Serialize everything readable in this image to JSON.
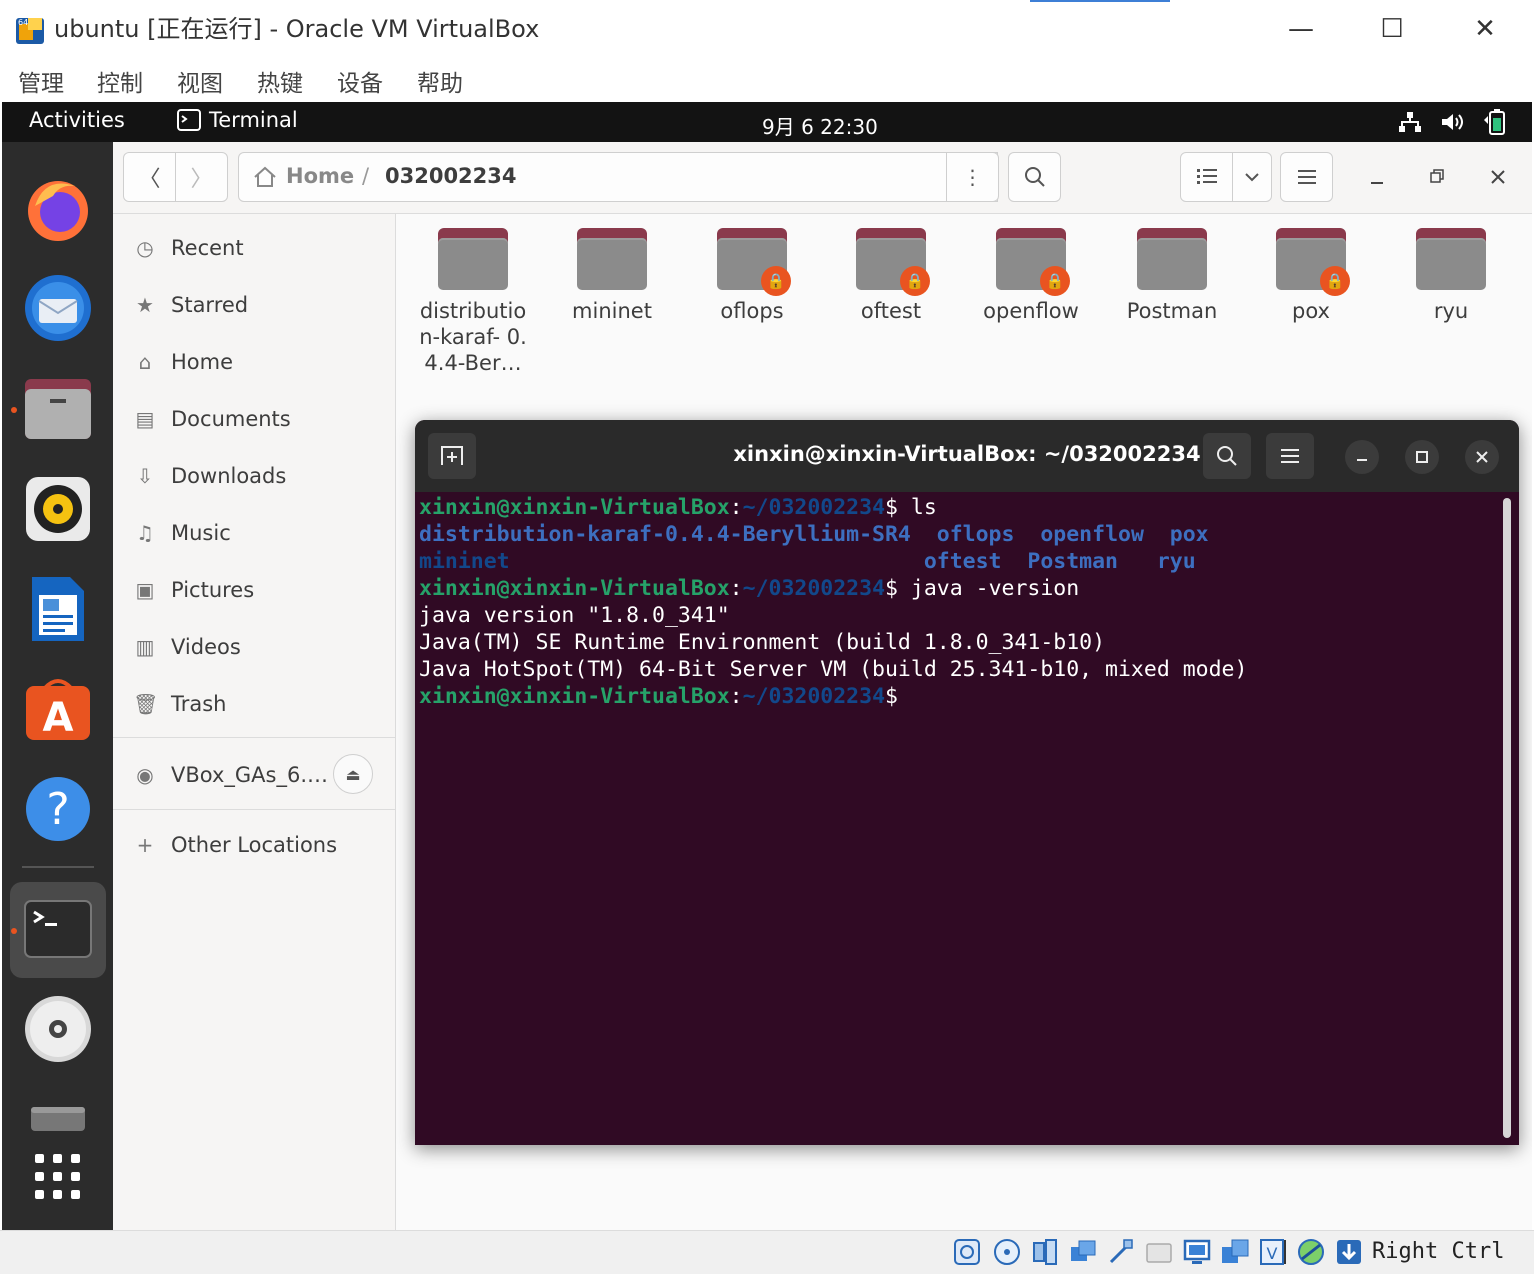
{
  "window": {
    "title": "ubuntu [正在运行] - Oracle VM VirtualBox",
    "app_icon": "virtualbox-icon",
    "controls": {
      "minimize": "—",
      "maximize": "☐",
      "close": "✕"
    }
  },
  "menubar": [
    "管理",
    "控制",
    "视图",
    "热键",
    "设备",
    "帮助"
  ],
  "gnome": {
    "activities": "Activities",
    "app_name": "Terminal",
    "clock": "9月 6  22:30",
    "tray_icons": [
      "network-icon",
      "volume-icon",
      "battery-icon"
    ]
  },
  "dock": [
    "firefox-icon",
    "thunderbird-icon",
    "files-icon",
    "rhythmbox-icon",
    "libreoffice-writer-icon",
    "ubuntu-software-icon",
    "help-icon",
    "terminal-icon",
    "dvd-icon",
    "drive-icon",
    "show-apps-icon"
  ],
  "files": {
    "path": {
      "home": "Home",
      "separator": "/",
      "current": "032002234"
    },
    "sidebar": [
      {
        "label": "Recent",
        "icon": "clock-icon"
      },
      {
        "label": "Starred",
        "icon": "star-icon"
      },
      {
        "label": "Home",
        "icon": "home-icon"
      },
      {
        "label": "Documents",
        "icon": "document-icon"
      },
      {
        "label": "Downloads",
        "icon": "download-icon"
      },
      {
        "label": "Music",
        "icon": "music-icon"
      },
      {
        "label": "Pictures",
        "icon": "picture-icon"
      },
      {
        "label": "Videos",
        "icon": "video-icon"
      },
      {
        "label": "Trash",
        "icon": "trash-icon"
      }
    ],
    "device": "VBox_GAs_6.…",
    "other_locations": "Other Locations",
    "folders": [
      {
        "name": "distributio n-karaf- 0.4.4-Ber…",
        "locked": false
      },
      {
        "name": "mininet",
        "locked": false
      },
      {
        "name": "oflops",
        "locked": true
      },
      {
        "name": "oftest",
        "locked": true
      },
      {
        "name": "openflow",
        "locked": true
      },
      {
        "name": "Postman",
        "locked": false
      },
      {
        "name": "pox",
        "locked": true
      },
      {
        "name": "ryu",
        "locked": false
      }
    ]
  },
  "terminal": {
    "title": "xinxin@xinxin-VirtualBox: ~/032002234",
    "prompt_user": "xinxin@xinxin-VirtualBox",
    "prompt_path": "~/032002234",
    "cmd1": "ls",
    "ls_row1": [
      "distribution-karaf-0.4.4-Beryllium-SR4",
      "oflops",
      "openflow",
      "pox"
    ],
    "ls_row2": [
      "mininet",
      "oftest",
      "Postman",
      "ryu"
    ],
    "cmd2": "java -version",
    "out1": "java version \"1.8.0_341\"",
    "out2": "Java(TM) SE Runtime Environment (build 1.8.0_341-b10)",
    "out3": "Java HotSpot(TM) 64-Bit Server VM (build 25.341-b10, mixed mode)"
  },
  "statusbar": {
    "host_key": "Right Ctrl"
  }
}
